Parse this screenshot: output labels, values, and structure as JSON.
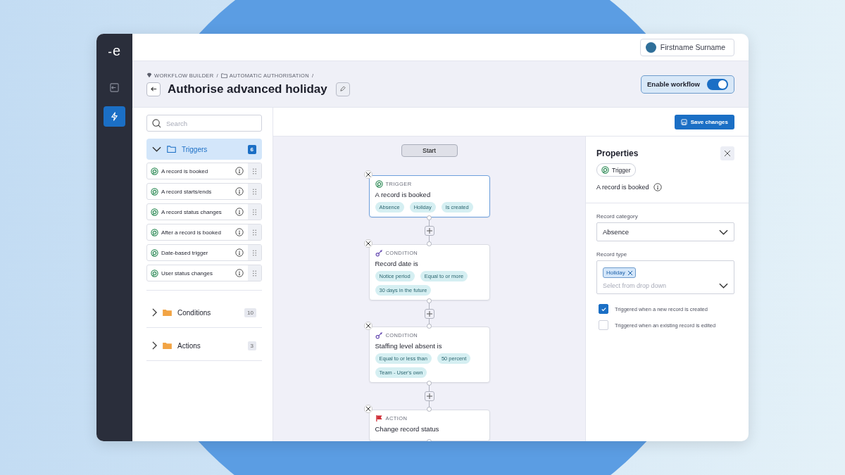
{
  "logo": "e",
  "rail": [
    {
      "kind": "exit",
      "selected": false
    },
    {
      "kind": "bolt",
      "selected": true
    }
  ],
  "user": {
    "name": "Firstname Surname"
  },
  "breadcrumb": [
    {
      "kind": "workflow",
      "label": "WORKFLOW BUILDER"
    },
    {
      "kind": "folder",
      "label": "AUTOMATIC AUTHORISATION"
    }
  ],
  "breadcrumb_separator": "/",
  "title": "Authorise advanced holiday",
  "enable_workflow": {
    "label": "Enable workflow",
    "on": true
  },
  "search": {
    "placeholder": "Search"
  },
  "groups": [
    {
      "label": "Triggers",
      "count": "6",
      "expanded": true,
      "items": [
        "A record is booked",
        "A record starts/ends",
        "A record status changes",
        "After a record is booked",
        "Date-based trigger",
        "User status changes"
      ]
    },
    {
      "label": "Conditions",
      "count": "10",
      "expanded": false
    },
    {
      "label": "Actions",
      "count": "3",
      "expanded": false
    }
  ],
  "save_button": "Save changes",
  "flow": {
    "start": "Start",
    "nodes": [
      {
        "kind": "trigger",
        "type_label": "TRIGGER",
        "title": "A record is booked",
        "selected": true,
        "chips": [
          "Absence",
          "Holiday",
          "Is created"
        ]
      },
      {
        "kind": "condition",
        "type_label": "CONDITION",
        "title": "Record date is",
        "selected": false,
        "chips": [
          "Notice period",
          "Equal to or more",
          "30 days in the future"
        ]
      },
      {
        "kind": "condition",
        "type_label": "CONDITION",
        "title": "Staffing level absent is",
        "selected": false,
        "chips": [
          "Equal to or less than",
          "50 percent",
          "Team - User's own"
        ]
      },
      {
        "kind": "action",
        "type_label": "ACTION",
        "title": "Change record status",
        "selected": false
      }
    ]
  },
  "properties": {
    "title": "Properties",
    "badge": "Trigger",
    "subtitle": "A record is booked",
    "category": {
      "label": "Record category",
      "value": "Absence"
    },
    "type": {
      "label": "Record type",
      "tags": [
        "Holiday"
      ],
      "placeholder": "Select from drop down"
    },
    "checks": [
      {
        "label": "Triggered when a new record is created",
        "checked": true
      },
      {
        "label": "Triggered when an existing record is edited",
        "checked": false
      }
    ]
  }
}
